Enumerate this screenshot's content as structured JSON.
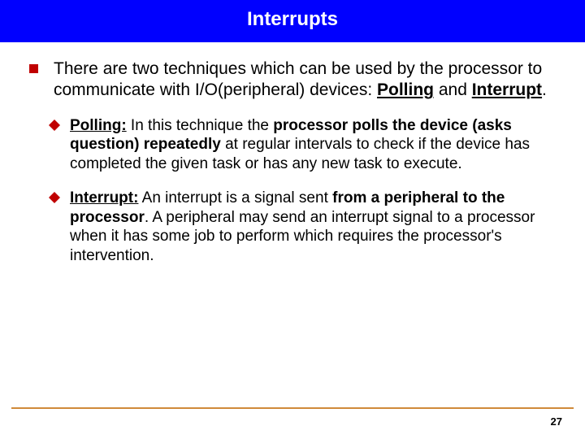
{
  "title": "Interrupts",
  "intro": {
    "pre": "There are two techniques which can be used by the processor to communicate with  I/O(peripheral) devices: ",
    "kw1": "Polling",
    "mid": " and ",
    "kw2": "Interrupt",
    "post": "."
  },
  "polling": {
    "label": "Polling:",
    "pre": " In this technique the ",
    "bold": "processor polls the device (asks question) repeatedly",
    "post": " at regular intervals to check if the device has completed the given task or has any new task to execute."
  },
  "interrupt": {
    "label": "Interrupt:",
    "pre": " An interrupt is a signal sent ",
    "bold": "from a peripheral to the processor",
    "post": ".  A peripheral may send an interrupt signal to a processor when it has some job to perform which requires the processor's intervention."
  },
  "page": "27"
}
